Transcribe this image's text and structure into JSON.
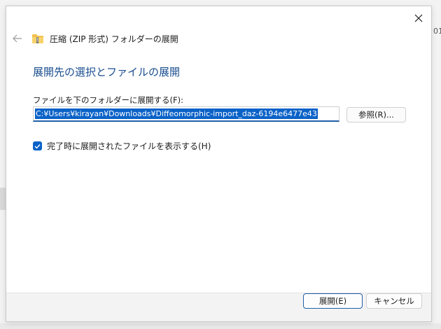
{
  "background": {
    "right_edge_text": "01"
  },
  "dialog": {
    "title": "圧縮 (ZIP 形式) フォルダーの展開",
    "heading": "展開先の選択とファイルの展開",
    "path_label": "ファイルを下のフォルダーに展開する(F):",
    "path_value": "C:¥Users¥kirayan¥Downloads¥Diffeomorphic-import_daz-6194e6477e43",
    "browse_label": "参照(R)...",
    "show_files_label": "完了時に展開されたファイルを表示する(H)",
    "show_files_checked": true,
    "extract_label": "展開(E)",
    "cancel_label": "キャンセル"
  },
  "colors": {
    "accent": "#0a62c8",
    "heading": "#1a4e8f"
  },
  "icons": {
    "close": "close-icon",
    "back": "back-arrow-icon",
    "folder": "zip-folder-icon",
    "check": "checkmark-icon"
  }
}
